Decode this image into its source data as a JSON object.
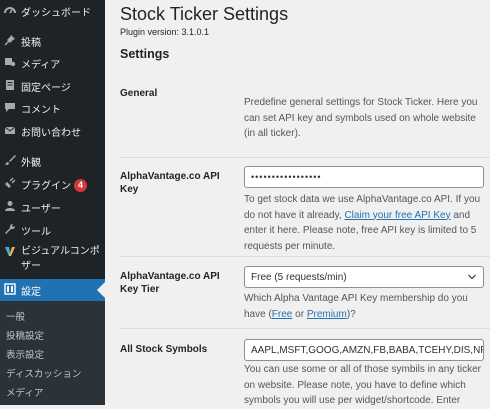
{
  "sidebar": {
    "items": [
      {
        "label": "ダッシュボード",
        "icon": "dashboard-icon"
      },
      {
        "label": "投稿",
        "icon": "pin-icon"
      },
      {
        "label": "メディア",
        "icon": "media-icon"
      },
      {
        "label": "固定ページ",
        "icon": "page-icon"
      },
      {
        "label": "コメント",
        "icon": "comment-icon"
      },
      {
        "label": "お問い合わせ",
        "icon": "mail-icon"
      },
      {
        "label": "外観",
        "icon": "brush-icon"
      },
      {
        "label": "プラグイン",
        "icon": "plugin-icon",
        "badge": "4"
      },
      {
        "label": "ユーザー",
        "icon": "user-icon"
      },
      {
        "label": "ツール",
        "icon": "wrench-icon"
      },
      {
        "label": "ビジュアルコンポ\nザー",
        "icon": "composer-icon"
      },
      {
        "label": "設定",
        "icon": "settings-icon",
        "current": true
      }
    ],
    "submenu": [
      "一般",
      "投稿設定",
      "表示設定",
      "ディスカッション",
      "メディア"
    ]
  },
  "main": {
    "page_title": "Stock Ticker Settings",
    "plugin_version": "Plugin version: 3.1.0.1",
    "section_title": "Settings",
    "general": {
      "label": "General",
      "description": "Predefine general settings for Stock Ticker. Here you can set API key and symbols used on whole website (in all ticker)."
    },
    "api_key": {
      "label": "AlphaVantage.co API Key",
      "value": "•••••••••••••••••",
      "desc_before": "To get stock data we use AlphaVantage.co API. If you do not have it already, ",
      "link": "Claim your free API Key",
      "desc_after": " and enter it here. Please note, free API key is limited to 5 requests per minute."
    },
    "api_tier": {
      "label": "AlphaVantage.co API Key Tier",
      "selected": "Free (5 requests/min)",
      "desc_before": "Which Alpha Vantage API Key membership do you have (",
      "link_free": "Free",
      "desc_mid": " or ",
      "link_premium": "Premium",
      "desc_after": ")?"
    },
    "symbols": {
      "label": "All Stock Symbols",
      "value": "AAPL,MSFT,GOOG,AMZN,FB,BABA,TCEHY,DIS,NFLX",
      "description": "You can use some or all of those symbils in any ticker on website. Please note, you have to define which symbols you will use per widget/shortcode. Enter"
    }
  },
  "colors": {
    "sidebar_bg": "#1d2327",
    "current_menu": "#2271b1",
    "badge": "#d63638",
    "link": "#2271b1"
  }
}
